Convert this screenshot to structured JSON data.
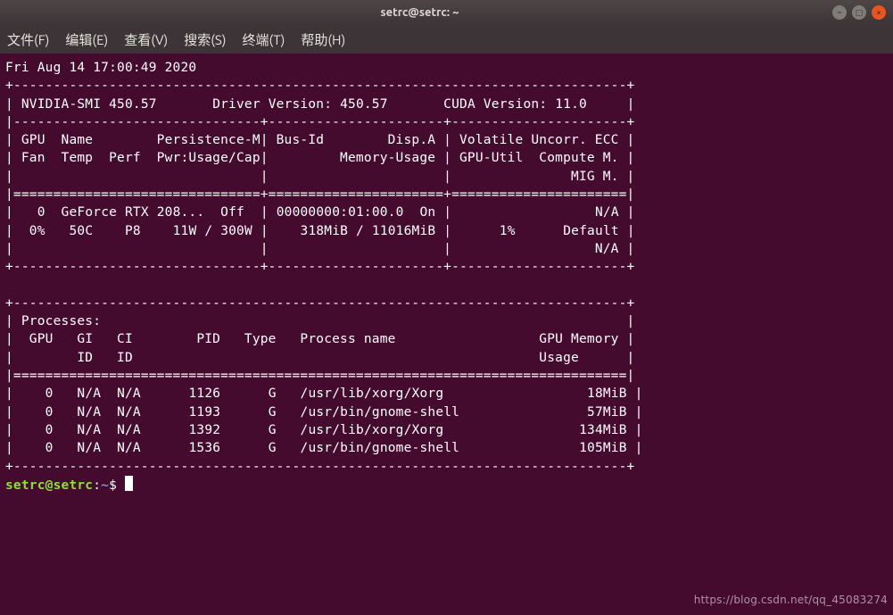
{
  "window": {
    "title": "setrc@setrc: ~"
  },
  "menu": {
    "file": "文件(F)",
    "edit": "编辑(E)",
    "view": "查看(V)",
    "search": "搜索(S)",
    "terminal": "终端(T)",
    "help": "帮助(H)"
  },
  "smi": {
    "date": "Fri Aug 14 17:00:49 2020",
    "version": "450.57",
    "driver": "450.57",
    "cuda": "11.0",
    "gpu": {
      "index": "0",
      "name": "GeForce RTX 208...",
      "persistence": "Off",
      "fan": "0%",
      "temp": "50C",
      "perf": "P8",
      "pwr": "11W / 300W",
      "bus": "00000000:01:00.0",
      "disp": "On",
      "mem": "318MiB / 11016MiB",
      "util": "1%",
      "ecc": "N/A",
      "compute": "Default",
      "mig": "N/A"
    },
    "procs": [
      {
        "gpu": "0",
        "gi": "N/A",
        "ci": "N/A",
        "pid": "1126",
        "type": "G",
        "name": "/usr/lib/xorg/Xorg",
        "mem": "18MiB"
      },
      {
        "gpu": "0",
        "gi": "N/A",
        "ci": "N/A",
        "pid": "1193",
        "type": "G",
        "name": "/usr/bin/gnome-shell",
        "mem": "57MiB"
      },
      {
        "gpu": "0",
        "gi": "N/A",
        "ci": "N/A",
        "pid": "1392",
        "type": "G",
        "name": "/usr/lib/xorg/Xorg",
        "mem": "134MiB"
      },
      {
        "gpu": "0",
        "gi": "N/A",
        "ci": "N/A",
        "pid": "1536",
        "type": "G",
        "name": "/usr/bin/gnome-shell",
        "mem": "105MiB"
      }
    ]
  },
  "prompt": {
    "user_host": "setrc@setrc",
    "sep": ":",
    "cwd": "~",
    "end": "$"
  },
  "watermark": "https://blog.csdn.net/qq_45083274"
}
